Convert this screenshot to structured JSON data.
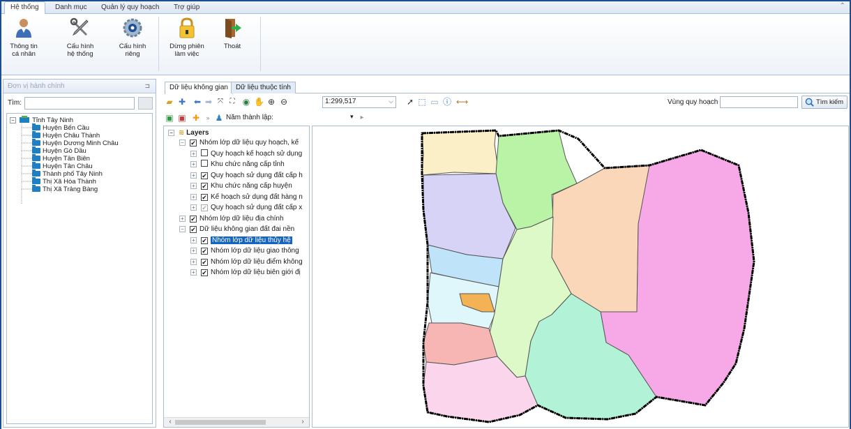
{
  "ribbon": {
    "tabs": [
      "Hệ thống",
      "Danh mục",
      "Quản lý quy hoạch",
      "Trợ giúp"
    ],
    "buttons": {
      "profile": [
        "Thông tin",
        "cá nhân"
      ],
      "system_config": [
        "Cấu hình",
        "hệ thống"
      ],
      "private_config": [
        "Cấu hình",
        "riêng"
      ],
      "end_session": [
        "Dừng phiên",
        "làm việc"
      ],
      "exit": [
        "Thoát"
      ]
    }
  },
  "left_panel": {
    "title": "Đơn vị hành chính",
    "search_label": "Tìm:",
    "tree": {
      "root": "Tỉnh Tây Ninh",
      "children": [
        "Huyện Bến Cầu",
        "Huyện Châu Thành",
        "Huyện Dương Minh Châu",
        "Huyện Gò Dầu",
        "Huyện Tân Biên",
        "Huyện Tân Châu",
        "Thành phố Tây Ninh",
        "Thị Xã Hòa Thành",
        "Thị Xã Trảng Bàng"
      ]
    }
  },
  "doc_tabs": [
    "Dữ liệu không gian",
    "Dữ liệu thuộc tính"
  ],
  "toolbar": {
    "scale": "1:299,517",
    "planning_zone_label": "Vùng quy hoạch",
    "planning_zone_value": "",
    "search_button": "Tìm kiếm",
    "year_label": "Năm thành lập:"
  },
  "layers": {
    "root": "Layers",
    "items": [
      {
        "label": "Nhóm lớp dữ liệu quy hoạch, kế",
        "level": 1,
        "expand": "−",
        "check": "✔"
      },
      {
        "label": "Quy hoạch kế hoạch sử dụng",
        "level": 2,
        "expand": "+",
        "check": ""
      },
      {
        "label": "Khu chức năng cấp tỉnh",
        "level": 2,
        "expand": "+",
        "check": ""
      },
      {
        "label": "Quy hoạch sử dụng đất cấp h",
        "level": 2,
        "expand": "+",
        "check": "✔"
      },
      {
        "label": "Khu chức năng cấp huyện",
        "level": 2,
        "expand": "+",
        "check": "✔"
      },
      {
        "label": "Kế hoạch sử dụng đất hàng n",
        "level": 2,
        "expand": "+",
        "check": "✔"
      },
      {
        "label": "Quy hoạch sử dụng đất cấp x",
        "level": 2,
        "expand": "+",
        "check": "gray"
      },
      {
        "label": "Nhóm lớp dữ liệu địa chính",
        "level": 1,
        "expand": "+",
        "check": "✔"
      },
      {
        "label": "Dữ liệu không gian đất đai nền",
        "level": 1,
        "expand": "−",
        "check": "✔"
      },
      {
        "label": "Nhóm lớp dữ liệu thủy hệ",
        "level": 2,
        "expand": "+",
        "check": "✔",
        "selected": true
      },
      {
        "label": "Nhóm lớp dữ liệu giao thông",
        "level": 2,
        "expand": "+",
        "check": "✔"
      },
      {
        "label": "Nhóm lớp dữ liệu điểm không",
        "level": 2,
        "expand": "+",
        "check": "✔"
      },
      {
        "label": "Nhóm lớp dữ liệu biên giới đị",
        "level": 2,
        "expand": "+",
        "check": "✔"
      }
    ]
  },
  "colors": {
    "ribbon_border": "#a9bed6",
    "selection": "#1565c0",
    "region_yellow": "#fbefc8",
    "region_green": "#b9f3a6",
    "region_lavender": "#d6d3f6",
    "region_peach": "#fbd7b9",
    "region_pink": "#f7a8e6",
    "region_lightblue": "#bfe3f8",
    "region_cyan": "#dff7fb",
    "region_orange": "#f3b253",
    "region_lime": "#ddf9c8",
    "region_mint": "#b2f2d6",
    "region_salmon": "#f7b6b4",
    "region_lightpink": "#fad5ec"
  }
}
